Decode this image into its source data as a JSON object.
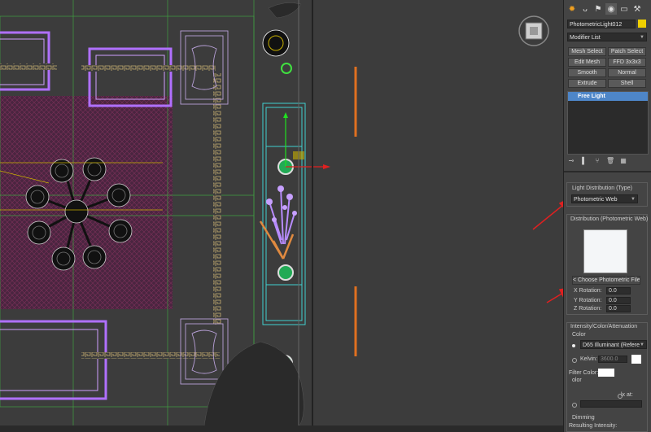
{
  "toolbar": {
    "icons": [
      "sun-icon",
      "curve-icon",
      "hierarchy-icon",
      "motion-icon",
      "display-icon",
      "utilities-icon"
    ]
  },
  "object": {
    "name": "PhotometricLight012",
    "color": "#f0d000"
  },
  "modifier_list": {
    "label": "Modifier List"
  },
  "modifier_buttons": [
    {
      "label": "Mesh Select"
    },
    {
      "label": "Patch Select"
    },
    {
      "label": "Edit Mesh"
    },
    {
      "label": "FFD 3x3x3"
    },
    {
      "label": "Smooth"
    },
    {
      "label": "Normal"
    },
    {
      "label": "Extrude"
    },
    {
      "label": "Shell"
    }
  ],
  "stack": {
    "selected": "Free Light"
  },
  "light_distribution": {
    "title": "Light Distribution (Type)",
    "value": "Photometric Web"
  },
  "photometric_web": {
    "title": "Distribution (Photometric Web)",
    "choose_file": "< Choose Photometric File >",
    "x_rotation_label": "X Rotation:",
    "x_rotation": "0.0",
    "y_rotation_label": "Y Rotation:",
    "y_rotation": "0.0",
    "z_rotation_label": "Z Rotation:",
    "z_rotation": "0.0"
  },
  "intensity": {
    "title": "Intensity/Color/Attenuation",
    "color_label": "Color",
    "illuminant": "D65 Illuminant (Refere",
    "kelvin_label": "Kelvin:",
    "kelvin_value": "3600.0",
    "filter_color_label": "Filter Color:",
    "intensity_label": "olor",
    "lx_at_label": "lx at:",
    "dimming_label": "Dimming",
    "resulting_label": "Resulting Intensity:"
  },
  "viewport": {
    "background": "#3c3c3c",
    "highlight_color": "#e07020"
  }
}
